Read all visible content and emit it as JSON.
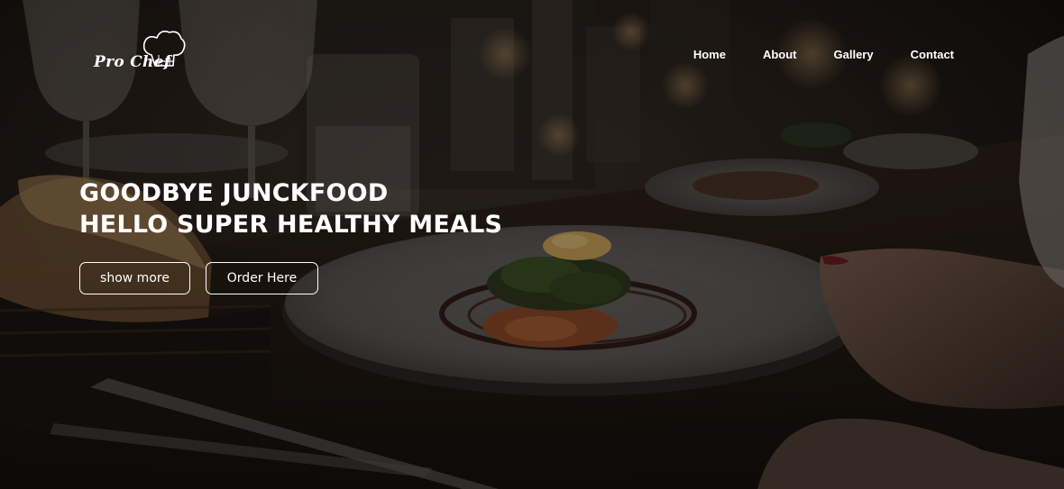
{
  "brand": {
    "name": "Pro Chef",
    "logo_icon": "chef-hat-icon"
  },
  "nav": {
    "items": [
      {
        "label": "Home"
      },
      {
        "label": "About"
      },
      {
        "label": "Gallery"
      },
      {
        "label": "Contact"
      }
    ]
  },
  "hero": {
    "headline_line1": "GOODBYE JUNCKFOOD",
    "headline_line2": "HELLO SUPER HEALTHY MEALS",
    "buttons": {
      "show_more": "show more",
      "order_here": "Order Here"
    },
    "background_description_icon": "restaurant-dinner-photo"
  },
  "colors": {
    "text": "#ffffff",
    "overlay": "#000000"
  }
}
